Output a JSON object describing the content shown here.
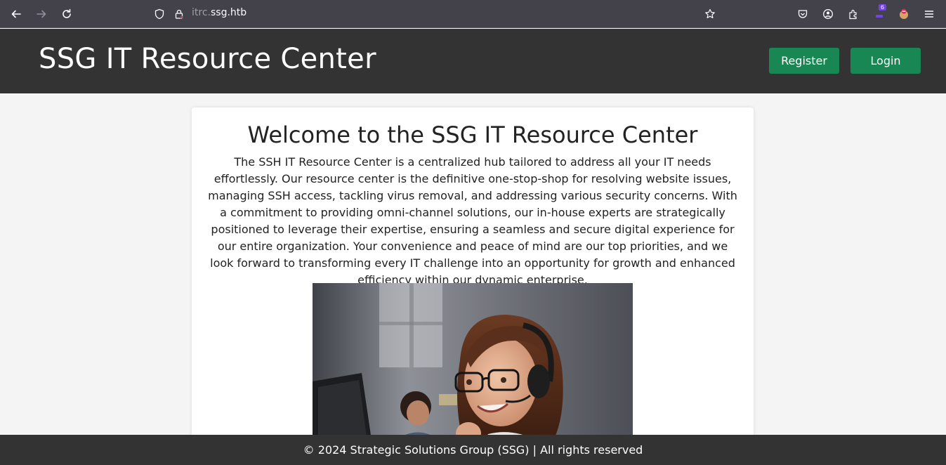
{
  "browser": {
    "url_prefix": "itrc.",
    "url_domain": "ssg.htb",
    "extension_badge": "6",
    "icons": [
      "back-icon",
      "forward-icon",
      "reload-icon",
      "shield-icon",
      "lock-icon",
      "star-icon",
      "pocket-icon",
      "account-icon",
      "extensions-icon",
      "menu-icon"
    ]
  },
  "header": {
    "title": "SSG IT Resource Center",
    "register_label": "Register",
    "login_label": "Login",
    "accent": "#198754",
    "bg": "#333333"
  },
  "main": {
    "heading": "Welcome to the SSG IT Resource Center",
    "intro": "The SSH IT Resource Center is a centralized hub tailored to address all your IT needs effortlessly. Our resource center is the definitive one-stop-shop for resolving website issues, managing SSH access, tackling virus removal, and addressing various security concerns. With a commitment to providing omni-channel solutions, our in-house experts are strategically positioned to leverage their expertise, ensuring a seamless and secure digital experience for our entire organization. Your convenience and peace of mind are our top priorities, and we look forward to transforming every IT challenge into an opportunity for growth and enhanced efficiency within our dynamic enterprise."
  },
  "footer": {
    "text": "© 2024 Strategic Solutions Group (SSG) | All rights reserved"
  }
}
